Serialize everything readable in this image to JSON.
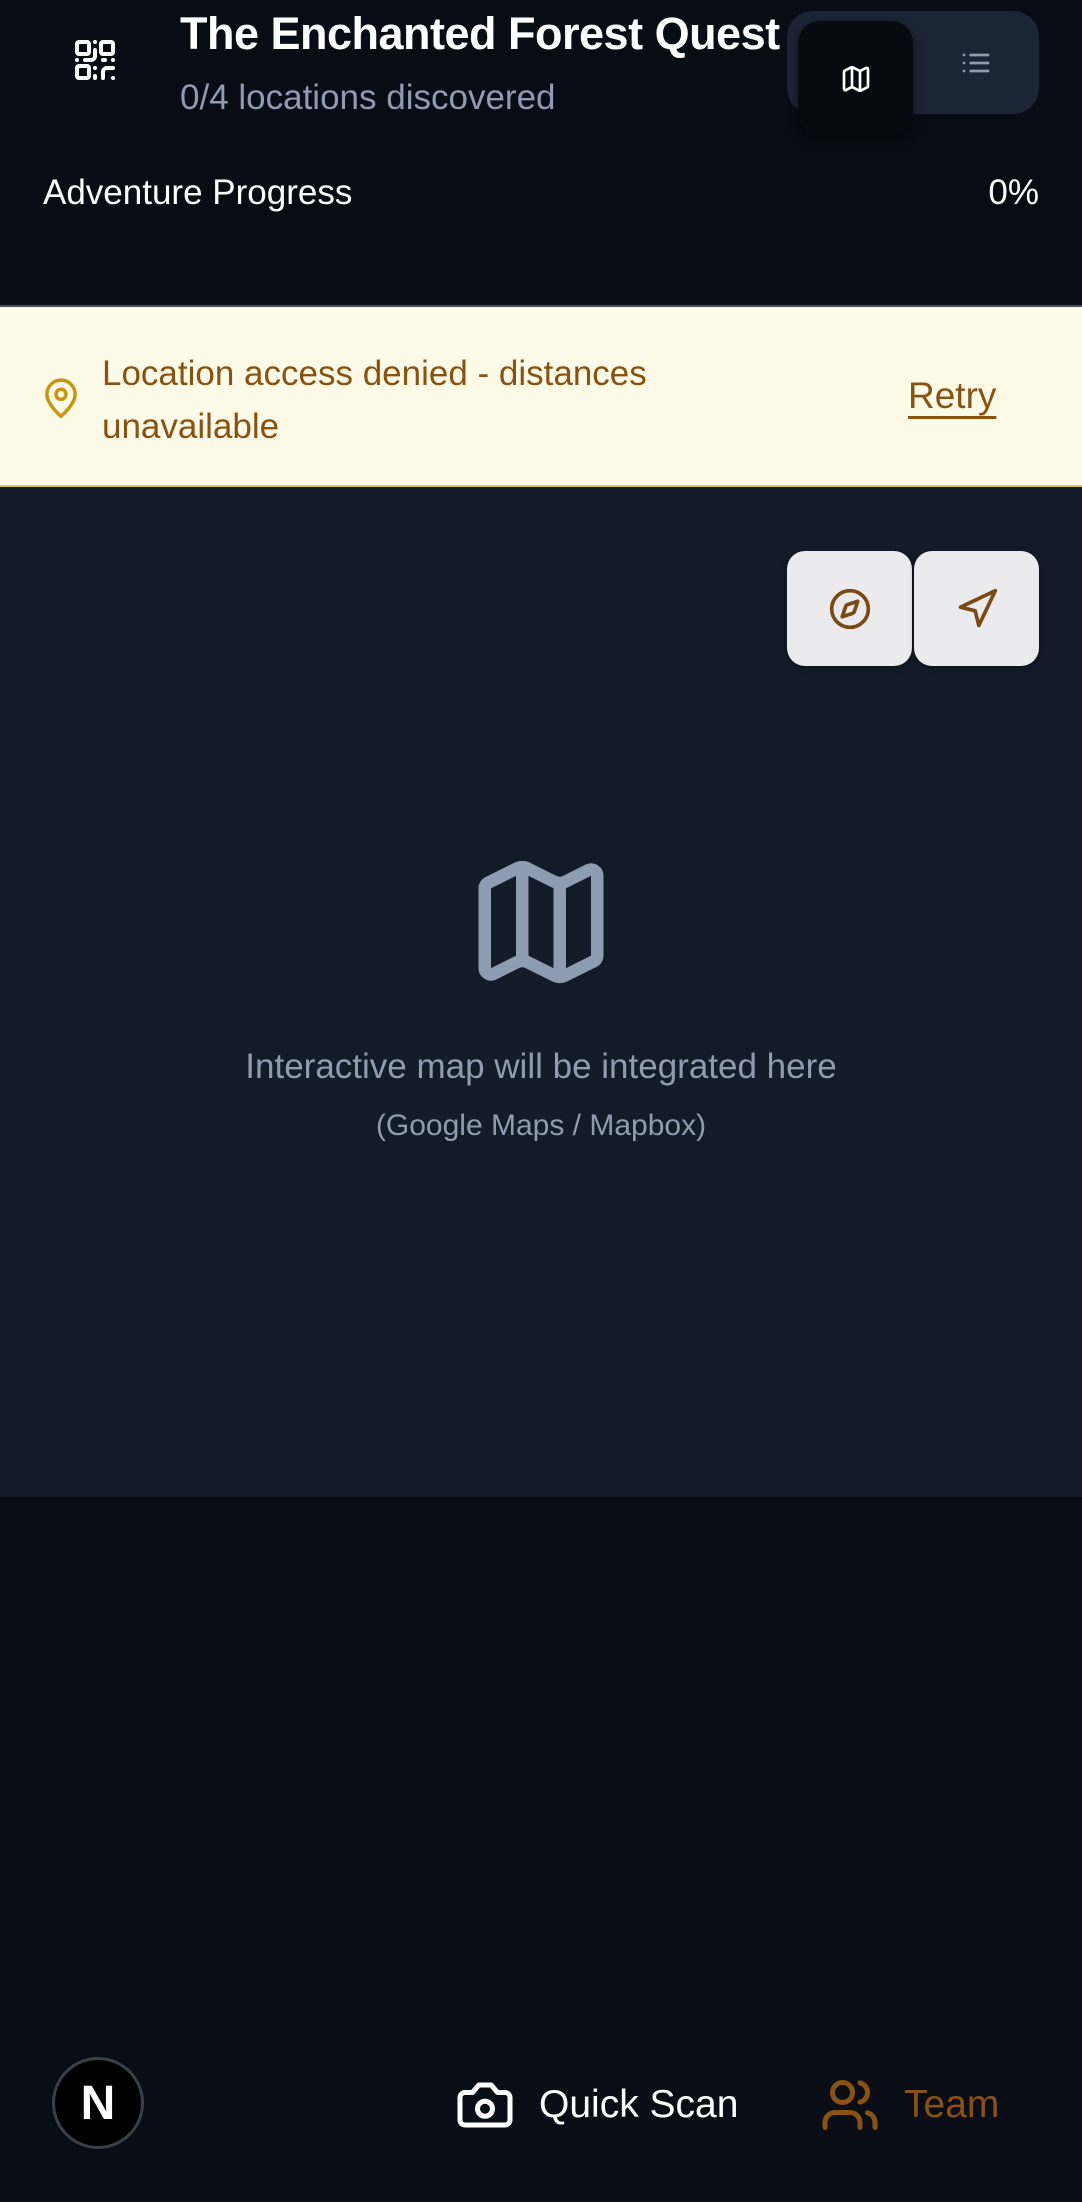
{
  "header": {
    "title": "The Enchanted Forest Quest",
    "subtitle": "0/4 locations discovered",
    "progress_label": "Adventure Progress",
    "progress_value": "0%",
    "progress_fraction": 0,
    "qr_icon": "qr-code-icon",
    "view_toggle": {
      "active": "map",
      "map_icon": "map-icon",
      "list_icon": "list-icon"
    }
  },
  "alert": {
    "icon": "map-pin-icon",
    "message": "Location access denied - distances unavailable",
    "retry_label": "Retry"
  },
  "map": {
    "compass_icon": "compass-icon",
    "locate_icon": "navigation-icon",
    "placeholder_icon": "map-icon",
    "placeholder_text": "Interactive map will be integrated here",
    "placeholder_sub": "(Google Maps / Mapbox)"
  },
  "bottom_bar": {
    "avatar_letter": "N",
    "quick_scan_label": "Quick Scan",
    "quick_scan_icon": "camera-icon",
    "team_label": "Team",
    "team_icon": "users-icon"
  },
  "colors": {
    "background": "#090d16",
    "map_background": "#131b28",
    "alert_background": "#fefae8",
    "accent_amber": "#8a5210",
    "muted_text": "#8f9bb0"
  }
}
